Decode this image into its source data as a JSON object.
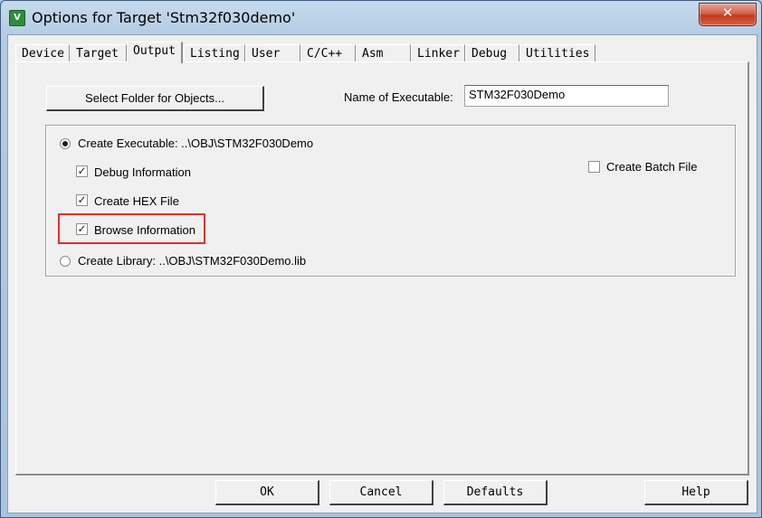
{
  "window": {
    "title": "Options for Target 'Stm32f030demo'",
    "icon": "uvision-icon",
    "close_glyph": "✕"
  },
  "tabs": [
    {
      "label": "Device",
      "active": false
    },
    {
      "label": "Target",
      "active": false
    },
    {
      "label": "Output",
      "active": true
    },
    {
      "label": "Listing",
      "active": false
    },
    {
      "label": "User",
      "active": false
    },
    {
      "label": "C/C++",
      "active": false
    },
    {
      "label": "Asm",
      "active": false
    },
    {
      "label": "Linker",
      "active": false
    },
    {
      "label": "Debug",
      "active": false
    },
    {
      "label": "Utilities",
      "active": false
    }
  ],
  "output": {
    "select_folder_label": "Select Folder for Objects...",
    "name_of_executable_label": "Name of Executable:",
    "name_of_executable_value": "STM32F030Demo",
    "create_executable": {
      "label": "Create Executable:  ..\\OBJ\\STM32F030Demo",
      "selected": true
    },
    "debug_information": {
      "label": "Debug Information",
      "checked": true
    },
    "create_hex_file": {
      "label": "Create HEX File",
      "checked": true
    },
    "browse_information": {
      "label": "Browse Information",
      "checked": true
    },
    "create_library": {
      "label": "Create Library:  ..\\OBJ\\STM32F030Demo.lib",
      "selected": false
    },
    "create_batch_file": {
      "label": "Create Batch File",
      "checked": false
    }
  },
  "buttons": {
    "ok": "OK",
    "cancel": "Cancel",
    "defaults": "Defaults",
    "help": "Help"
  },
  "colors": {
    "highlight": "#e0312a",
    "close_button": "#c94b34"
  }
}
